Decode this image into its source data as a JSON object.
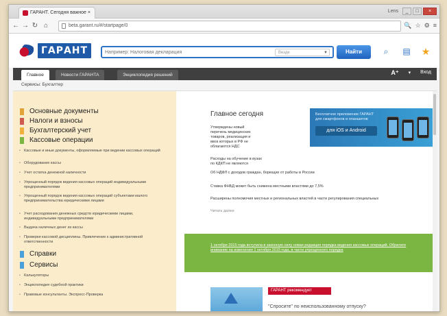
{
  "browser": {
    "tab_title": "ГАРАНТ. Сегодня важное ×",
    "url": "beta.garant.ru/#/startpage/0",
    "user": "Lens",
    "controls": [
      "_",
      "□",
      "×"
    ]
  },
  "site": {
    "logo_text": "ГАРАНТ",
    "search_placeholder": "Например: Налоговая декларация",
    "search_scope": "Везде",
    "find_label": "Найти",
    "nav_tabs": [
      "Главное",
      "Новости ГАРАНТА",
      "Энциклопедия решений"
    ],
    "font_size_label": "A⁺",
    "font_size_dd": "▾",
    "help_label": "Вход",
    "breadcrumb": "Сервисы: Бухгалтер"
  },
  "sidebar": {
    "main_items": [
      {
        "label": "Основные документы",
        "color": "#e2a23a"
      },
      {
        "label": "Налоги и взносы",
        "color": "#d05a4f"
      },
      {
        "label": "Бухгалтерский учет",
        "color": "#f0b23c"
      },
      {
        "label": "Кассовые операции",
        "color": "#7bb542"
      }
    ],
    "sub_items": [
      "Кассовые и иные документы, оформляемые при ведении кассовых операций",
      "Оборудование кассы",
      "Учет остатка денежной наличности",
      "Упрощенный порядок ведения кассовых операций индивидуальными предпринимателями",
      "Упрощенный порядок ведения кассовых операций субъектами малого предпринимательства юридическими лицами",
      "Учет расходования денежных средств юридическими лицами, индивидуальными предпринимателями",
      "Выдача наличных денег из кассы",
      "Проверки кассовой дисциплины. Привлечение к административной ответственности"
    ],
    "lower_items": [
      {
        "label": "Справки",
        "color": "#4aa0d8"
      },
      {
        "label": "Сервисы",
        "color": "#4aa0d8"
      }
    ],
    "lower_sub_items": [
      "Калькуляторы",
      "Энциклопедия судебной практики",
      "Правовые консультанты. Экспресс-Проверка"
    ]
  },
  "main": {
    "title": "Главное сегодня",
    "news": [
      "Утверждены новый перечень медицинских товаров, реализация и ввоз которых в РФ не облагаются НДС",
      "Расходы на обучение в вузах по КДКП не являются",
      "Об НДФЛ с доходов граждан, борющих от работы в России",
      "Ставка ФНБД может быть снижена местными властями до 7,5%",
      "Расширены полномочия местных и региональных властей в части регулирования специальных",
      "Читать далее"
    ],
    "promo_text": "Бесплатное приложение ГАРАНТ для смартфонов и планшетов",
    "promo_platforms": "для iOS и Android",
    "banner_text": "1 октября 2015 года вступила в законную силу новая редакция порядка ведения кассовых операций. Обратите внимание на изменения 1 октября 2015 года, в части упрощенного порядка",
    "rec_badge": "ГАРАНТ рекомендует",
    "rec_title": "\"Спросите\" по неиспользованному отпуску?"
  }
}
